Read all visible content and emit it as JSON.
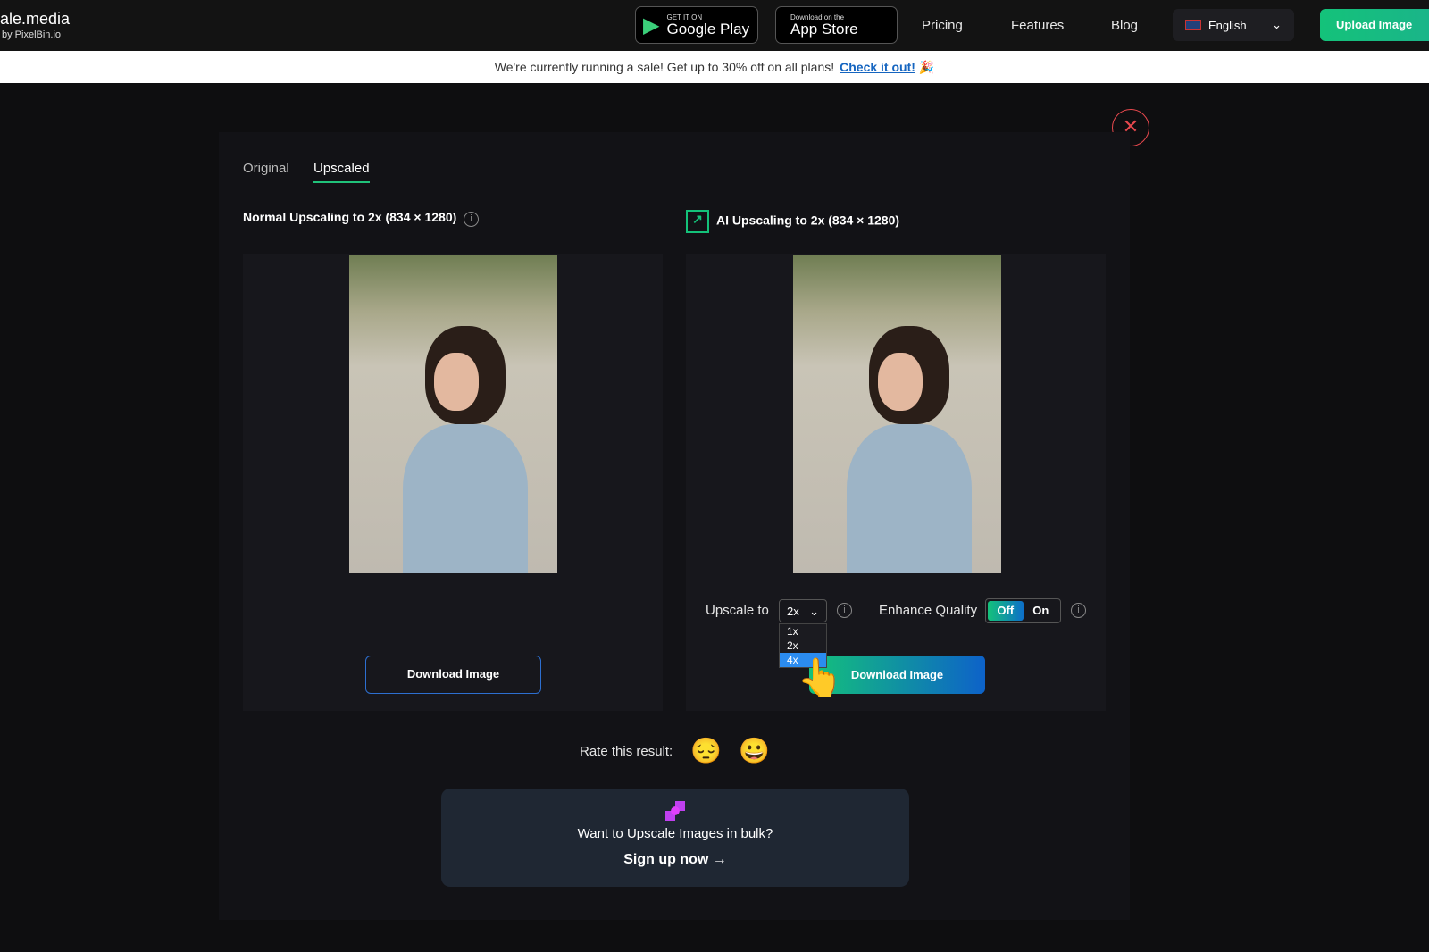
{
  "header": {
    "logo": "ale.media",
    "logo_sub": "by PixelBin.io",
    "google_small": "GET IT ON",
    "google_large": "Google Play",
    "apple_small": "Download on the",
    "apple_large": "App Store",
    "nav": [
      "Pricing",
      "Features",
      "Blog"
    ],
    "language": "English",
    "upload": "Upload Image"
  },
  "banner": {
    "text": "We're currently running a sale! Get up to 30% off on all plans!",
    "link": "Check it out!"
  },
  "tabs": [
    "Original",
    "Upscaled"
  ],
  "left": {
    "title": "Normal Upscaling to 2x (834 × 1280)",
    "download": "Download Image"
  },
  "right": {
    "title": "AI Upscaling to 2x (834 × 1280)",
    "download": "Download Image",
    "upscale_label": "Upscale to",
    "upscale_value": "2x",
    "options": [
      "1x",
      "2x",
      "4x"
    ],
    "highlighted": "4x",
    "enhance_label": "Enhance Quality",
    "toggle_off": "Off",
    "toggle_on": "On",
    "toggle_state": "Off"
  },
  "rate": {
    "label": "Rate this result:",
    "emojis": [
      "😔",
      "😀"
    ]
  },
  "bulk": {
    "text": "Want to Upscale Images in bulk?",
    "link": "Sign up now →"
  },
  "colors": {
    "accent": "#14c27a",
    "blue": "#0d62c9",
    "close": "#e5484d"
  }
}
